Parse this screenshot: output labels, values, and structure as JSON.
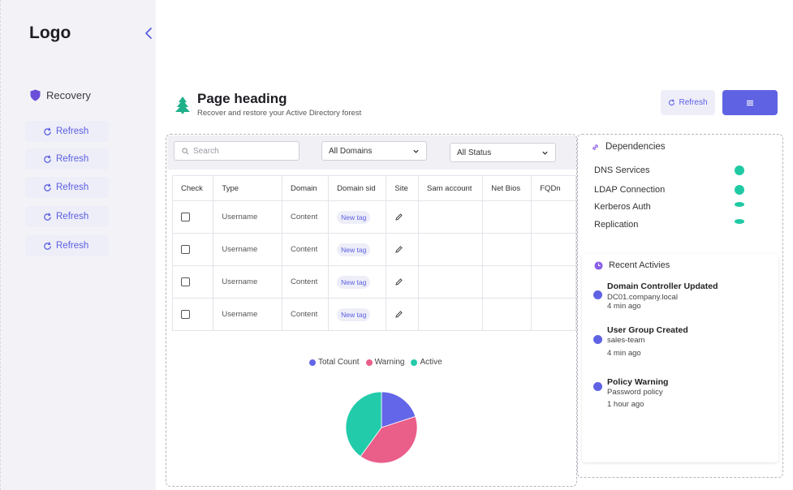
{
  "sidebar": {
    "logo": "Logo",
    "section_label": "Recovery",
    "items": [
      {
        "label": "Refresh"
      },
      {
        "label": "Refresh"
      },
      {
        "label": "Refresh"
      },
      {
        "label": "Refresh"
      },
      {
        "label": "Refresh"
      }
    ]
  },
  "header": {
    "title": "Page heading",
    "subtitle": "Recover and restore your Active Directory forest",
    "refresh_label": "Refresh"
  },
  "filters": {
    "search_placeholder": "Search",
    "domain_select": "All Domains",
    "status_select": "All Status"
  },
  "table": {
    "columns": [
      "Check",
      "Type",
      "Domain",
      "Domain sid",
      "Site",
      "Sam account",
      "Net Bios",
      "FQDn"
    ],
    "rows": [
      {
        "type": "Username",
        "domain": "Content",
        "tag": "New tag"
      },
      {
        "type": "Username",
        "domain": "Content",
        "tag": "New tag"
      },
      {
        "type": "Username",
        "domain": "Content",
        "tag": "New tag"
      },
      {
        "type": "Username",
        "domain": "Content",
        "tag": "New tag"
      }
    ]
  },
  "chart_data": {
    "type": "pie",
    "title": "",
    "legend": [
      "Total Count",
      "Warning",
      "Active"
    ],
    "legend_position": "top",
    "colors": [
      "#6366e8",
      "#ea5e8a",
      "#22cbaa"
    ],
    "values": [
      20,
      40,
      40
    ]
  },
  "dependencies": {
    "title": "Dependencies",
    "items": [
      {
        "label": "DNS Services",
        "status_color": "#1fc9a4"
      },
      {
        "label": "LDAP Connection",
        "status_color": "#1fc9a4"
      },
      {
        "label": "Kerberos Auth",
        "status_color": "#1fc9a4"
      },
      {
        "label": "Replication",
        "status_color": "#1fc9a4"
      }
    ]
  },
  "activities": {
    "title": "Recent Activies",
    "items": [
      {
        "title": "Domain Controller Updated",
        "detail": "DC01.company.local",
        "time": "4 min ago"
      },
      {
        "title": "User Group Created",
        "detail": "sales-team",
        "time": "4 min ago"
      },
      {
        "title": "Policy Warning",
        "detail": "Password policy",
        "time": "1 hour ago"
      }
    ]
  },
  "colors": {
    "accent": "#5f63e3",
    "success": "#1fc9a4"
  }
}
